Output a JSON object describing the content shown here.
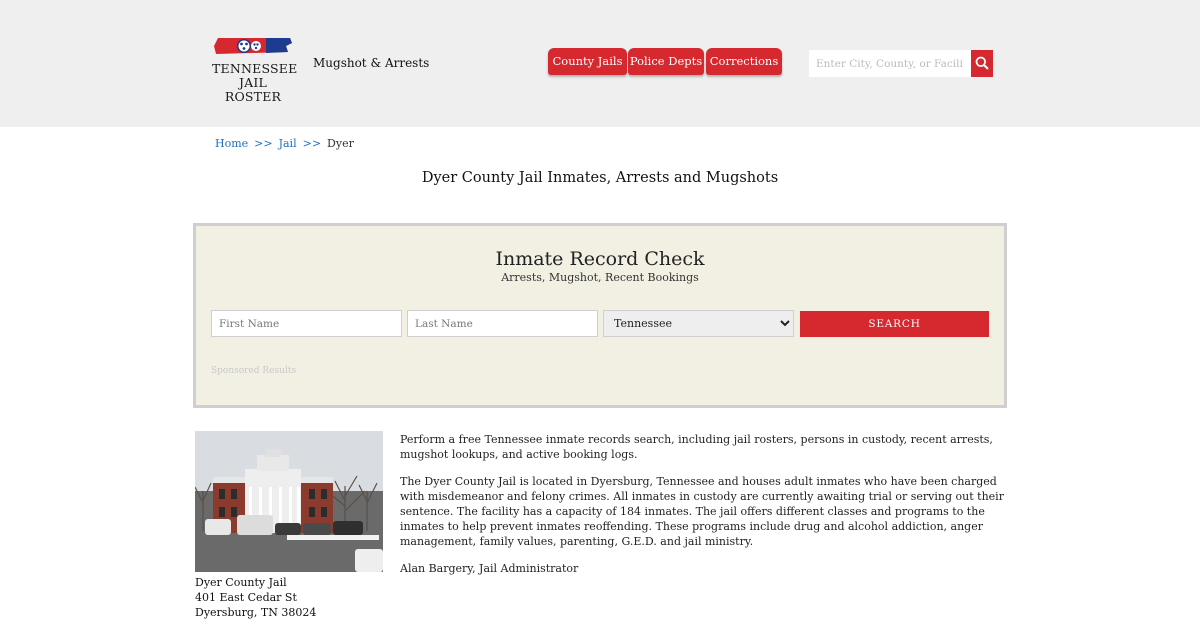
{
  "header": {
    "logo_line1": "TENNESSEE",
    "logo_line2": "JAIL ROSTER",
    "tagline": "Mugshot & Arrests",
    "nav": [
      "County Jails",
      "Police Depts",
      "Corrections"
    ],
    "search_placeholder": "Enter City, County, or Facility",
    "icons": {
      "search": "magnifier-icon",
      "logo": "tennessee-flag-icon"
    }
  },
  "breadcrumb": {
    "home": "Home",
    "sep": ">>",
    "jail": "Jail",
    "current": "Dyer"
  },
  "page_title": "Dyer County Jail Inmates, Arrests and Mugshots",
  "record_check": {
    "title": "Inmate Record Check",
    "subtitle": "Arrests, Mugshot, Recent Bookings",
    "first_placeholder": "First Name",
    "last_placeholder": "Last Name",
    "state_selected": "Tennessee",
    "button": "SEARCH",
    "sponsored": "Sponsored Results"
  },
  "facility": {
    "name": "Dyer County Jail",
    "street": "401 East Cedar St",
    "city": "Dyersburg, TN 38024"
  },
  "content": {
    "p1": "Perform a free Tennessee inmate records search, including jail rosters, persons in custody, recent arrests, mugshot lookups, and active booking logs.",
    "p2": "The Dyer County Jail is located in Dyersburg, Tennessee and houses adult inmates who have been charged with misdemeanor and felony crimes. All inmates in custody are currently awaiting trial or serving out their sentence. The facility has a capacity of 184 inmates. The jail offers different classes and programs to the inmates to help prevent inmates reoffending. These programs include drug and alcohol addiction, anger management, family values, parenting, G.E.D. and jail ministry.",
    "p3": "Alan Bargery, Jail Administrator"
  },
  "colors": {
    "accent": "#d6282f",
    "link": "#1f6fc5",
    "box_bg": "#f2f0e3",
    "header_bg": "#efefef"
  }
}
